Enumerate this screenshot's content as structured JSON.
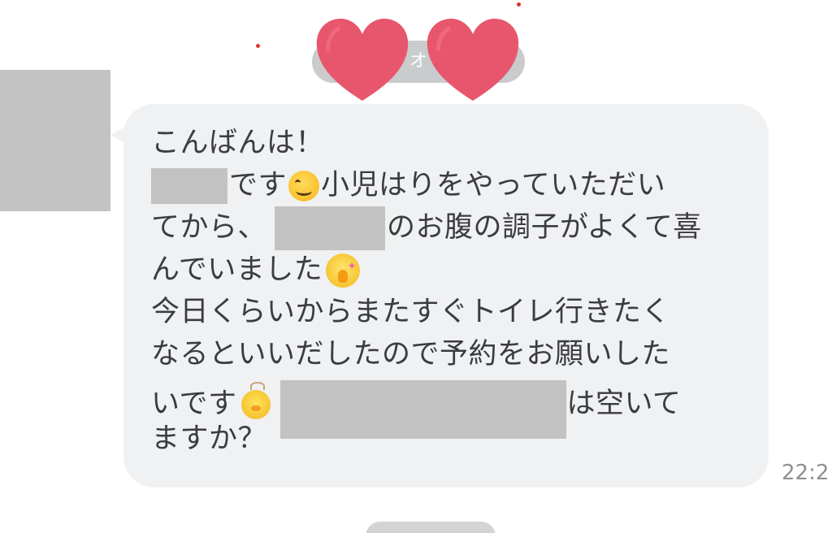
{
  "header": {
    "date_pill_text": "オ"
  },
  "message": {
    "lines": [
      [
        "こんばんは！"
      ],
      [
        "です",
        "小児はりをやっていただい"
      ],
      [
        "てから、",
        "のお腹の調子がよくて喜"
      ],
      [
        "んでいました"
      ],
      [
        "今日くらいからまたすぐトイレ行きたく"
      ],
      [
        "なるといいだしたので予約をお願いした"
      ],
      [
        "いです",
        "は空いて"
      ],
      [
        "ますか？"
      ]
    ],
    "time": "22:2"
  },
  "colors": {
    "bubble": "#f0f1f3",
    "text": "#3b3c3e",
    "redaction": "#c2c2c2",
    "heart": "#e8566d",
    "time": "#8e9094"
  },
  "icons": [
    "smiling-face-emoji-icon",
    "praying-chick-emoji-icon",
    "small-chick-emoji-icon",
    "heart-sticker-icon"
  ]
}
